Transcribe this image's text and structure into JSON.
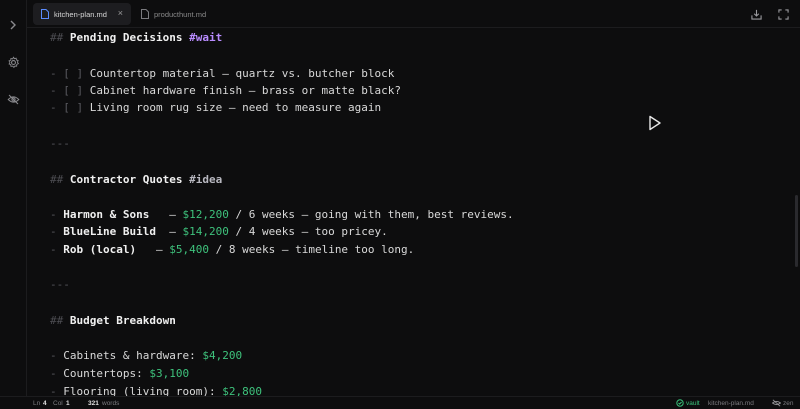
{
  "rail": {
    "icons": [
      "chevron-right-icon",
      "gear-icon",
      "eye-off-icon"
    ]
  },
  "tabs": [
    {
      "label": "kitchen-plan.md",
      "active": true,
      "close": "×"
    },
    {
      "label": "producthunt.md",
      "active": false
    }
  ],
  "toolbar": {
    "icons": [
      "download-icon",
      "expand-icon"
    ]
  },
  "doc": {
    "heading1": {
      "marker": "##",
      "text": "Pending Decisions",
      "tag": "#wait"
    },
    "tasks": [
      {
        "bullet": "-",
        "box": "[ ]",
        "text": "Countertop material — quartz vs. butcher block"
      },
      {
        "bullet": "-",
        "box": "[ ]",
        "text": "Cabinet hardware finish — brass or matte black?"
      },
      {
        "bullet": "-",
        "box": "[ ]",
        "text": "Living room rug size — need to measure again"
      }
    ],
    "hr": "---",
    "heading2": {
      "marker": "##",
      "text": "Contractor Quotes",
      "tag": "#idea"
    },
    "quotes": [
      {
        "bullet": "-",
        "name": "Harmon & Sons",
        "dash": "—",
        "price": "$12,200",
        "rest": " / 6 weeks — going with them, best reviews."
      },
      {
        "bullet": "-",
        "name": "BlueLine Build",
        "dash": "—",
        "price": "$14,200",
        "rest": " / 4 weeks — too pricey."
      },
      {
        "bullet": "-",
        "name": "Rob (local)",
        "dash": "—",
        "price": "$5,400",
        "rest": " / 8 weeks — timeline too long."
      }
    ],
    "heading3": {
      "marker": "##",
      "text": "Budget Breakdown"
    },
    "budget": [
      {
        "bullet": "-",
        "label": "Cabinets & hardware:",
        "amount": "$4,200"
      },
      {
        "bullet": "-",
        "label": "Countertops:",
        "amount": "$3,100"
      },
      {
        "bullet": "-",
        "label": "Flooring (living room):",
        "amount": "$2,800"
      }
    ]
  },
  "status": {
    "ln_label": "Ln",
    "ln": "4",
    "col_label": "Col",
    "col": "1",
    "words": "321",
    "words_label": "words",
    "vault": "vault",
    "file": "kitchen-plan.md",
    "zen": "zen"
  },
  "colors": {
    "accent_green": "#3ec27c",
    "tag_purple": "#b98cff",
    "background": "#0d0d0e"
  }
}
